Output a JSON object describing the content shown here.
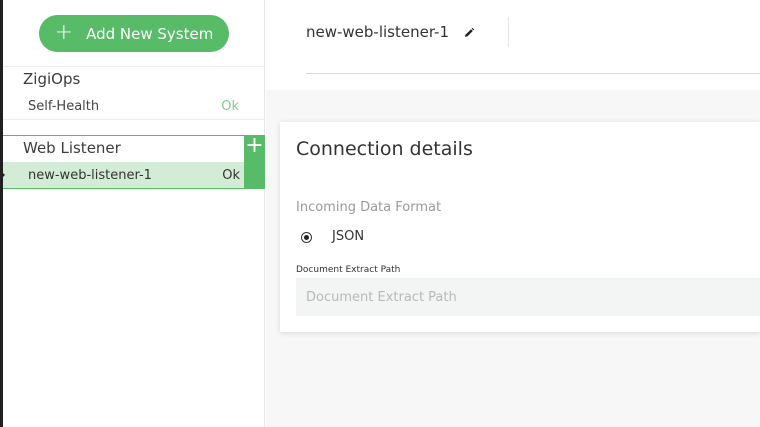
{
  "sidebar": {
    "add_button_label": "Add New System",
    "add_button_icon": "plus-icon",
    "groups": [
      {
        "title": "ZigiOps",
        "items": [
          {
            "name": "Self-Health",
            "status": "Ok"
          }
        ]
      },
      {
        "title": "Web Listener",
        "items": [
          {
            "name": "new-web-listener-1",
            "status": "Ok",
            "selected": true
          }
        ]
      }
    ]
  },
  "header": {
    "title": "new-web-listener-1",
    "edit_icon": "pencil-icon"
  },
  "card": {
    "title": "Connection details",
    "format_label": "Incoming Data Format",
    "format_option": "JSON",
    "path_label": "Document Extract Path",
    "path_placeholder": "Document Extract Path",
    "path_value": ""
  },
  "colors": {
    "accent_green": "#57bb68",
    "selected_bg": "#d3ecd6",
    "status_ok": "#7fcf8b"
  }
}
